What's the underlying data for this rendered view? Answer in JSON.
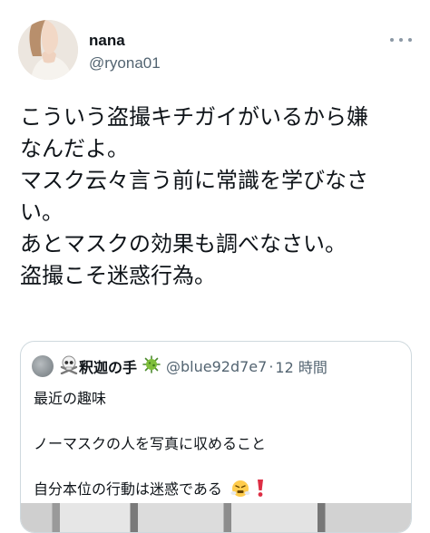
{
  "tweet": {
    "author": {
      "display_name": "nana",
      "handle": "@ryona01"
    },
    "more_icon": "more-horizontal-icon",
    "text_lines": [
      "こういう盗撮キチガイがいるから嫌",
      "なんだよ。",
      "マスク云々言う前に常識を学びなさ",
      "い。",
      "あとマスクの効果も調べなさい。",
      "盗撮こそ迷惑行為。"
    ]
  },
  "quote": {
    "author": {
      "display_name": "釈迦の手",
      "name_prefix_icon": "skull-and-crossbones-icon",
      "name_suffix_icon": "microbe-icon",
      "handle": "@blue92d7e7",
      "separator": "·",
      "time": "12 時間"
    },
    "lines": [
      "最近の趣味",
      "ノーマスクの人を写真に収めること",
      "自分本位の行動は迷惑である"
    ],
    "line3_icons": [
      "steam-face-icon",
      "exclamation-icon"
    ]
  }
}
